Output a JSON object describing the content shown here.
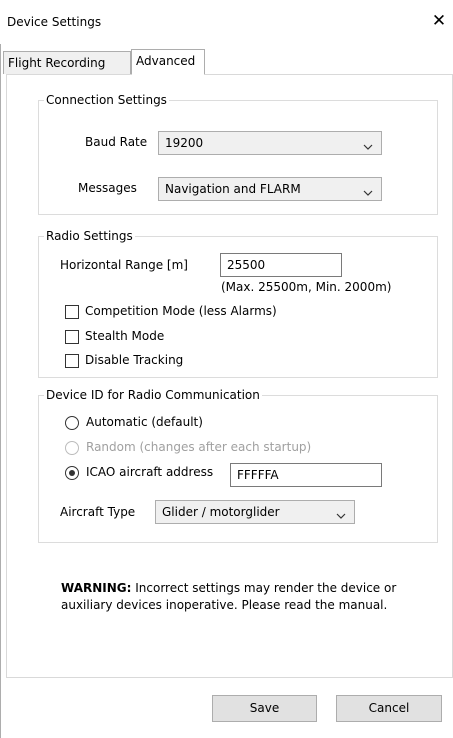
{
  "window": {
    "title": "Device Settings",
    "close_glyph": "✕"
  },
  "tabs": [
    {
      "label": "Flight Recording",
      "active": false
    },
    {
      "label": "Advanced",
      "active": true
    }
  ],
  "connection": {
    "legend": "Connection Settings",
    "baud_rate_label": "Baud Rate",
    "baud_rate_value": "19200",
    "messages_label": "Messages",
    "messages_value": "Navigation and FLARM"
  },
  "radio": {
    "legend": "Radio Settings",
    "range_label": "Horizontal Range [m]",
    "range_value": "25500",
    "range_hint": "(Max. 25500m, Min. 2000m)",
    "checkboxes": [
      {
        "label": "Competition Mode (less Alarms)",
        "checked": false
      },
      {
        "label": "Stealth Mode",
        "checked": false
      },
      {
        "label": "Disable Tracking",
        "checked": false
      }
    ]
  },
  "device_id": {
    "legend": "Device ID for Radio Communication",
    "options": [
      {
        "label": "Automatic (default)",
        "selected": false,
        "enabled": true
      },
      {
        "label": "Random (changes after each startup)",
        "selected": false,
        "enabled": false
      },
      {
        "label": "ICAO aircraft address",
        "selected": true,
        "enabled": true
      }
    ],
    "icao_value": "FFFFFA",
    "aircraft_type_label": "Aircraft Type",
    "aircraft_type_value": "Glider / motorglider"
  },
  "warning": {
    "bold": "WARNING:",
    "text": " Incorrect settings may render the device or auxiliary devices inoperative. Please read the manual."
  },
  "buttons": {
    "save": "Save",
    "cancel": "Cancel"
  },
  "icons": {
    "dropdown": "chevron-down-icon",
    "close": "close-icon"
  }
}
